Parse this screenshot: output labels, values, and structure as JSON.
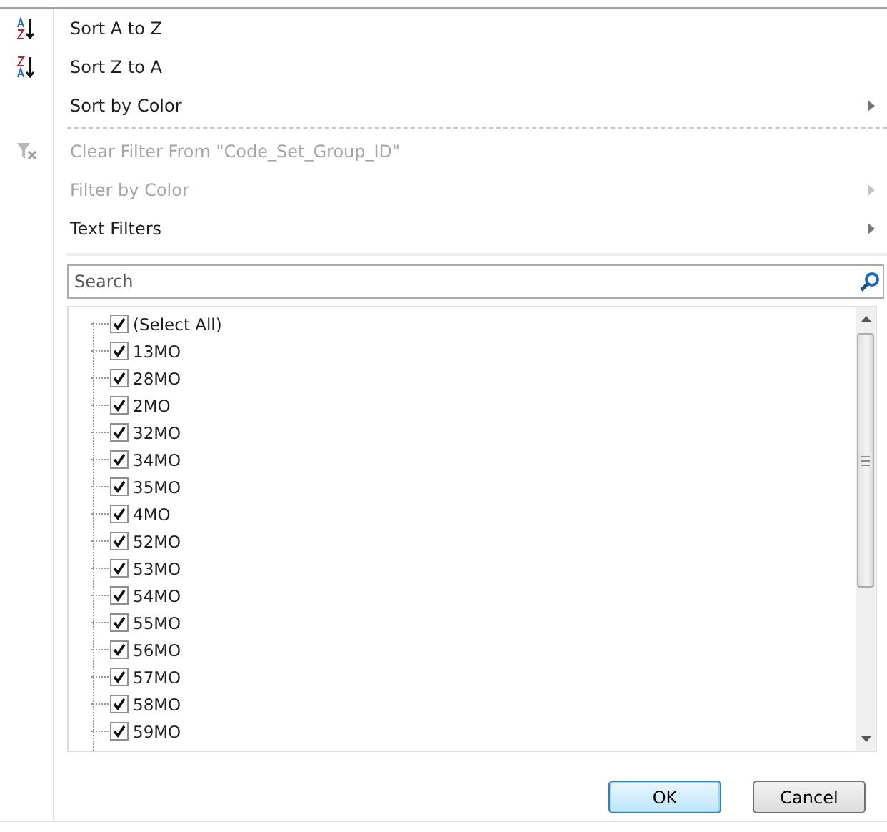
{
  "menu": [
    {
      "kind": "sort-ascending",
      "label": "Sort A to Z",
      "disabled": false,
      "submenu": false
    },
    {
      "kind": "sort-descending",
      "label": "Sort Z to A",
      "disabled": false,
      "submenu": false
    },
    {
      "kind": "item",
      "label": "Sort by Color",
      "disabled": false,
      "submenu": true
    },
    {
      "kind": "separator"
    },
    {
      "kind": "clear-filter",
      "label": "Clear Filter From \"Code_Set_Group_ID\"",
      "disabled": true,
      "submenu": false
    },
    {
      "kind": "item",
      "label": "Filter by Color",
      "disabled": true,
      "submenu": true
    },
    {
      "kind": "item",
      "label": "Text Filters",
      "disabled": false,
      "submenu": true
    }
  ],
  "search": {
    "placeholder": "Search"
  },
  "values": [
    {
      "label": "(Select All)",
      "checked": true
    },
    {
      "label": "13MO",
      "checked": true
    },
    {
      "label": "28MO",
      "checked": true
    },
    {
      "label": "2MO",
      "checked": true
    },
    {
      "label": "32MO",
      "checked": true
    },
    {
      "label": "34MO",
      "checked": true
    },
    {
      "label": "35MO",
      "checked": true
    },
    {
      "label": "4MO",
      "checked": true
    },
    {
      "label": "52MO",
      "checked": true
    },
    {
      "label": "53MO",
      "checked": true
    },
    {
      "label": "54MO",
      "checked": true
    },
    {
      "label": "55MO",
      "checked": true
    },
    {
      "label": "56MO",
      "checked": true
    },
    {
      "label": "57MO",
      "checked": true
    },
    {
      "label": "58MO",
      "checked": true
    },
    {
      "label": "59MO",
      "checked": true
    }
  ],
  "buttons": [
    {
      "label": "OK",
      "kind": "default"
    },
    {
      "label": "Cancel",
      "kind": "normal"
    }
  ]
}
